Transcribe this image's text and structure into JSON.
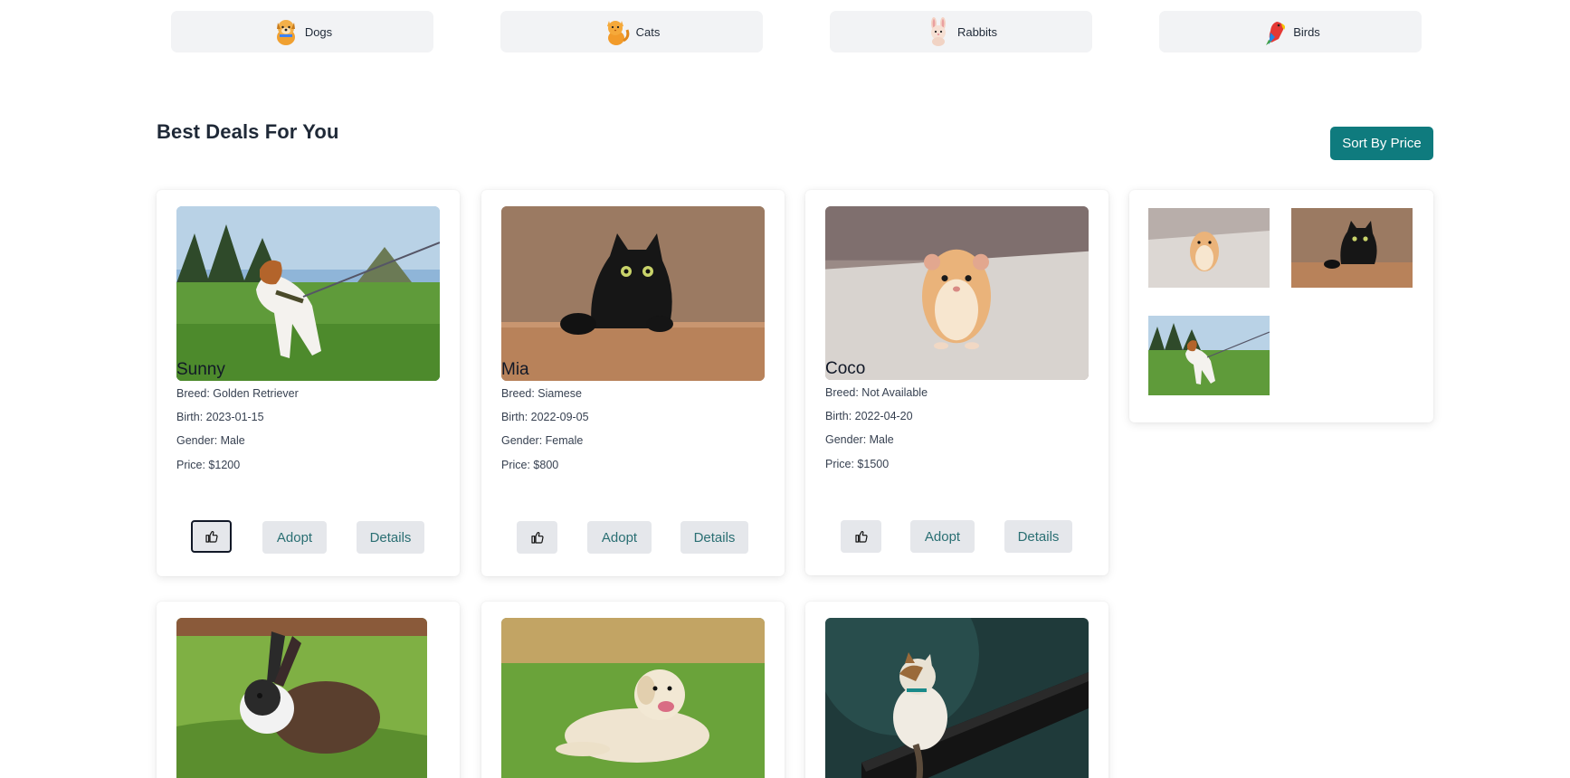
{
  "categories": [
    {
      "label": "Dogs",
      "icon": "dog-emoji-icon"
    },
    {
      "label": "Cats",
      "icon": "cat-emoji-icon"
    },
    {
      "label": "Rabbits",
      "icon": "rabbit-emoji-icon"
    },
    {
      "label": "Birds",
      "icon": "parrot-emoji-icon"
    }
  ],
  "deals": {
    "title": "Best Deals For You",
    "sort_label": "Sort By Price"
  },
  "pets": [
    {
      "name": "Sunny",
      "breed": "Breed: Golden Retriever",
      "birth": "Birth: 2023-01-15",
      "gender": "Gender: Male",
      "price": "Price: $1200",
      "adopt_label": "Adopt",
      "details_label": "Details",
      "photo": "dog-on-leash-photo"
    },
    {
      "name": "Mia",
      "breed": "Breed: Siamese",
      "birth": "Birth: 2022-09-05",
      "gender": "Gender: Female",
      "price": "Price: $800",
      "adopt_label": "Adopt",
      "details_label": "Details",
      "photo": "black-cat-photo"
    },
    {
      "name": "Coco",
      "breed": "Breed: Not Available",
      "birth": "Birth: 2022-04-20",
      "gender": "Gender: Male",
      "price": "Price: $1500",
      "adopt_label": "Adopt",
      "details_label": "Details",
      "photo": "hamster-photo"
    }
  ],
  "more_pets": [
    {
      "photo": "rabbit-in-grass-photo"
    },
    {
      "photo": "labrador-on-grass-photo"
    },
    {
      "photo": "cat-on-railing-photo"
    }
  ],
  "recent_thumbnails": [
    "hamster-thumbnail",
    "black-cat-thumbnail",
    "dog-thumbnail"
  ],
  "colors": {
    "accent": "#0f7b7e",
    "button_bg": "#e5e7eb",
    "button_text": "#2a6f73",
    "category_bg": "#f2f3f5"
  }
}
